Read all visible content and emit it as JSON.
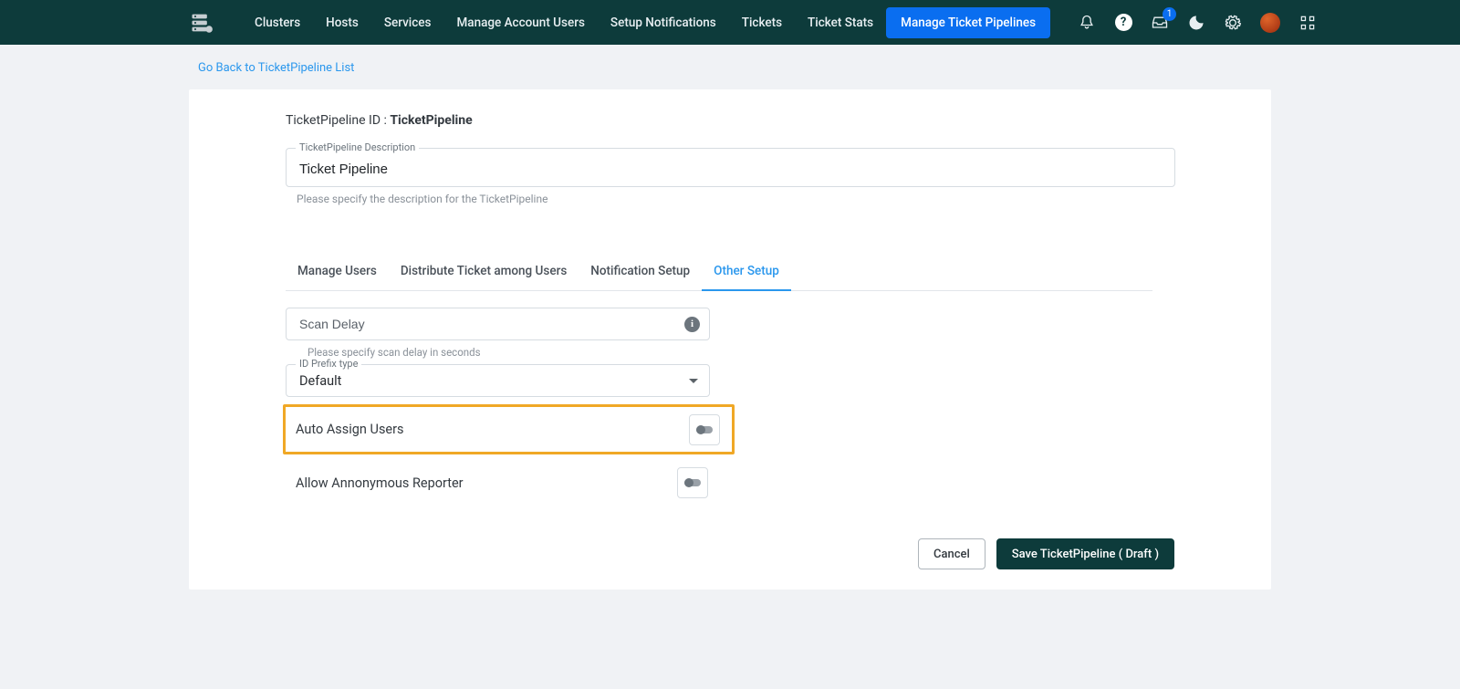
{
  "nav": {
    "items": [
      "Clusters",
      "Hosts",
      "Services",
      "Manage Account Users",
      "Setup Notifications",
      "Tickets",
      "Ticket Stats"
    ],
    "active": "Manage Ticket Pipelines"
  },
  "icons": {
    "inbox_badge": "1"
  },
  "back_link": "Go Back to TicketPipeline List",
  "header": {
    "prefix": "TicketPipeline ID : ",
    "value": "TicketPipeline"
  },
  "description": {
    "label": "TicketPipeline Description",
    "value": "Ticket Pipeline",
    "helper": "Please specify the description for the TicketPipeline"
  },
  "tabs": {
    "items": [
      "Manage Users",
      "Distribute Ticket among Users",
      "Notification Setup",
      "Other Setup"
    ]
  },
  "other": {
    "scan_delay": {
      "placeholder": "Scan Delay",
      "helper": "Please specify scan delay in seconds"
    },
    "prefix": {
      "label": "ID Prefix type",
      "value": "Default"
    },
    "auto_assign": {
      "label": "Auto Assign Users"
    },
    "anonymous": {
      "label": "Allow Annonymous Reporter"
    }
  },
  "footer": {
    "cancel": "Cancel",
    "save": "Save TicketPipeline ( Draft )"
  }
}
